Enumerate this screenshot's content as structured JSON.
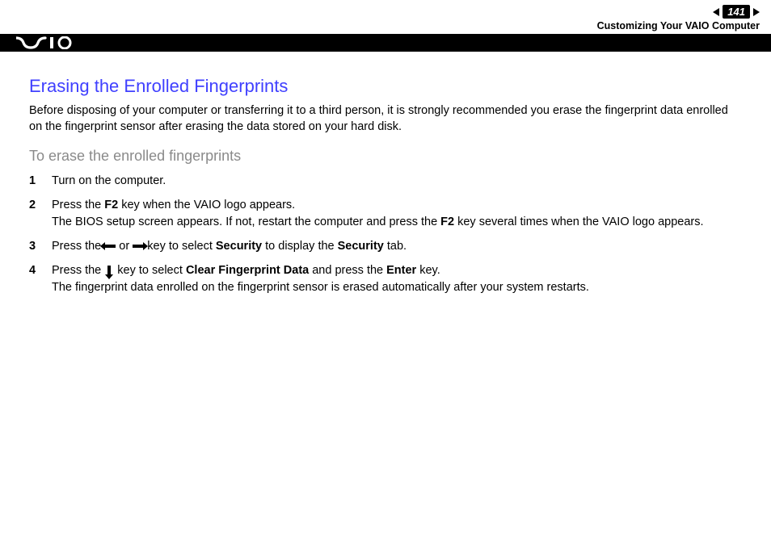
{
  "header": {
    "page_number": "141",
    "section": "Customizing Your VAIO Computer",
    "logo_alt": "VAIO"
  },
  "content": {
    "title": "Erasing the Enrolled Fingerprints",
    "intro": "Before disposing of your computer or transferring it to a third person, it is strongly recommended you erase the fingerprint data enrolled on the fingerprint sensor after erasing the data stored on your hard disk.",
    "subtitle": "To erase the enrolled fingerprints",
    "steps": {
      "s1": "Turn on the computer.",
      "s2_a": "Press the ",
      "s2_b": " key when the VAIO logo appears.",
      "s2_c": "The BIOS setup screen appears. If not, restart the computer and press the ",
      "s2_d": " key several times when the VAIO logo appears.",
      "s2_key": "F2",
      "s3_a": "Press the ",
      "s3_b": " or ",
      "s3_c": " key to select ",
      "s3_d": " to display the ",
      "s3_e": " tab.",
      "s3_sec": "Security",
      "s4_a": "Press the ",
      "s4_b": " key to select ",
      "s4_c": " and press the ",
      "s4_d": " key.",
      "s4_e": "The fingerprint data enrolled on the fingerprint sensor is erased automatically after your system restarts.",
      "s4_clear": "Clear Fingerprint Data",
      "s4_enter": "Enter"
    }
  }
}
